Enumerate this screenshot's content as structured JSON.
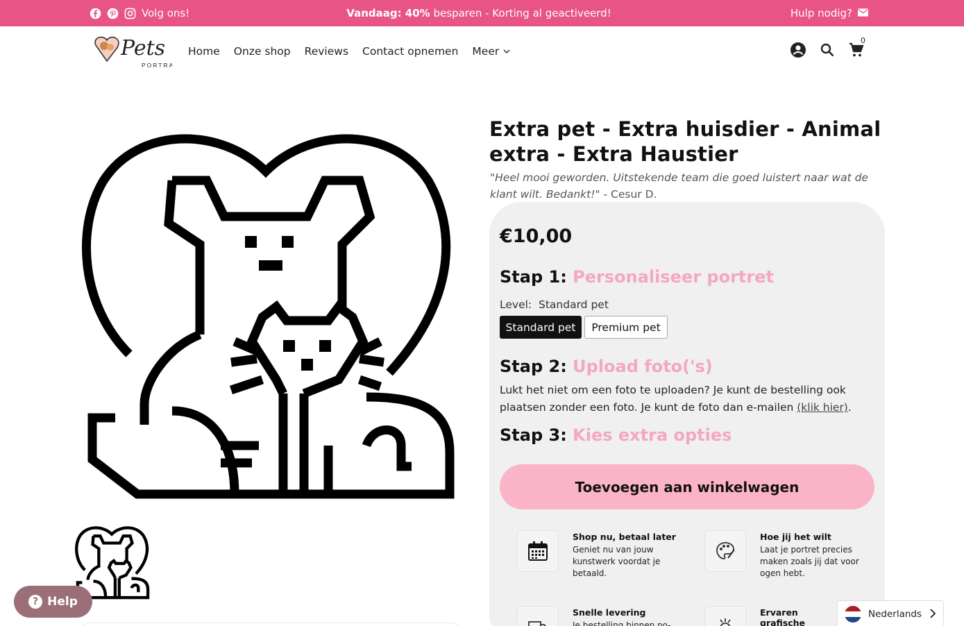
{
  "topbar": {
    "follow_label": "Volg ons!",
    "promo_bold": "Vandaag: 40%",
    "promo_rest": "besparen - Korting al geactiveerd!",
    "help_label": "Hulp nodig?",
    "bg_color": "#e85485"
  },
  "header": {
    "logo_text": "Pets",
    "logo_sub": "PORTRAIT",
    "nav": [
      {
        "label": "Home"
      },
      {
        "label": "Onze shop"
      },
      {
        "label": "Reviews"
      },
      {
        "label": "Contact opnemen"
      },
      {
        "label": "Meer"
      }
    ],
    "cart_count": "0",
    "icons": [
      "account-icon",
      "search-icon",
      "cart-icon"
    ]
  },
  "product": {
    "title": "Extra pet - Extra huisdier - Animal extra - Extra Haustier",
    "quote_text": "\"Heel mooi geworden. Uitstekende team die goed luistert naar wat de klant wilt. Bedankt!\"",
    "quote_author": " - Cesur D.",
    "price": "€10,00",
    "step1_label": "Stap 1:",
    "step1_title": "Personaliseer portret",
    "level_label": "Level:",
    "level_value": "Standard pet",
    "options": [
      "Standard pet",
      "Premium pet"
    ],
    "step2_label": "Stap 2:",
    "step2_title": "Upload foto('s)",
    "upload_text": "Lukt het niet om een foto te uploaden? Je kunt de bestelling ook plaatsen zonder een foto. Je kunt de foto dan e-mailen ",
    "upload_link": "(klik hier)",
    "upload_end": ".",
    "step3_label": "Stap 3:",
    "step3_title": "Kies extra opties",
    "add_to_cart": "Toevoegen aan winkelwagen",
    "accent_color": "#f5a7c0",
    "button_color": "#fbb3c8"
  },
  "features": [
    {
      "title": "Shop nu, betaal later",
      "desc": "Geniet nu van jouw kunstwerk voordat je betaald.",
      "icon": "calendar-icon"
    },
    {
      "title": "Hoe jij het wilt",
      "desc": "Laat je portret precies maken zoals jij dat voor ogen hebt.",
      "icon": "palette-icon"
    },
    {
      "title": "Snelle levering",
      "desc": "Je bestelling binnen no-",
      "icon": "truck-icon"
    },
    {
      "title": "Ervaren grafische designers",
      "desc": "",
      "icon": "medal-icon"
    }
  ],
  "widgets": {
    "help_button": "Help",
    "language": "Nederlands"
  }
}
